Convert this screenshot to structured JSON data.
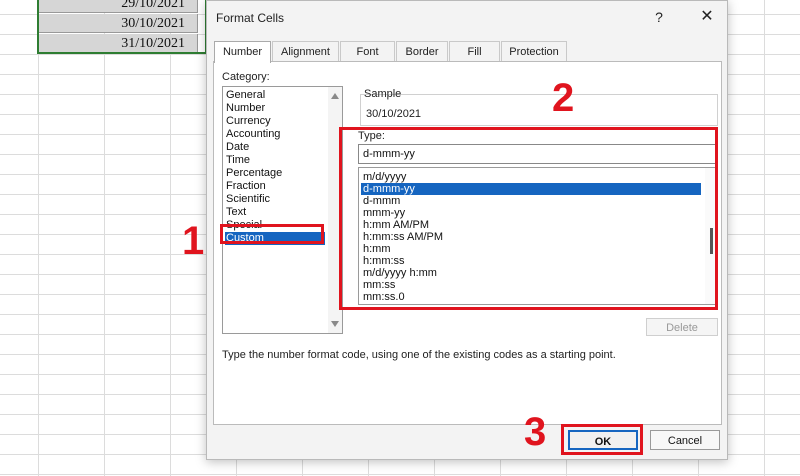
{
  "sheet": {
    "cells": [
      "29/10/2021",
      "30/10/2021",
      "31/10/2021"
    ]
  },
  "dialog": {
    "title": "Format Cells",
    "help_glyph": "?",
    "close_glyph": "✕",
    "tabs": [
      {
        "label": "Number",
        "active": true
      },
      {
        "label": "Alignment"
      },
      {
        "label": "Font"
      },
      {
        "label": "Border"
      },
      {
        "label": "Fill"
      },
      {
        "label": "Protection"
      }
    ],
    "category": {
      "label": "Category:",
      "items": [
        "General",
        "Number",
        "Currency",
        "Accounting",
        "Date",
        "Time",
        "Percentage",
        "Fraction",
        "Scientific",
        "Text",
        "Special",
        "Custom"
      ],
      "selected": "Custom"
    },
    "sample": {
      "label": "Sample",
      "value": "30/10/2021"
    },
    "type": {
      "label": "Type:",
      "value": "d-mmm-yy",
      "items": [
        "m/d/yyyy",
        "d-mmm-yy",
        "d-mmm",
        "mmm-yy",
        "h:mm AM/PM",
        "h:mm:ss AM/PM",
        "h:mm",
        "h:mm:ss",
        "m/d/yyyy h:mm",
        "mm:ss",
        "mm:ss.0"
      ],
      "selected": "d-mmm-yy"
    },
    "delete_label": "Delete",
    "help_text": "Type the number format code, using one of the existing codes as a starting point.",
    "ok_label": "OK",
    "cancel_label": "Cancel"
  },
  "annotations": {
    "step1": "1",
    "step2": "2",
    "step3": "3",
    "color": "#e0141e"
  }
}
